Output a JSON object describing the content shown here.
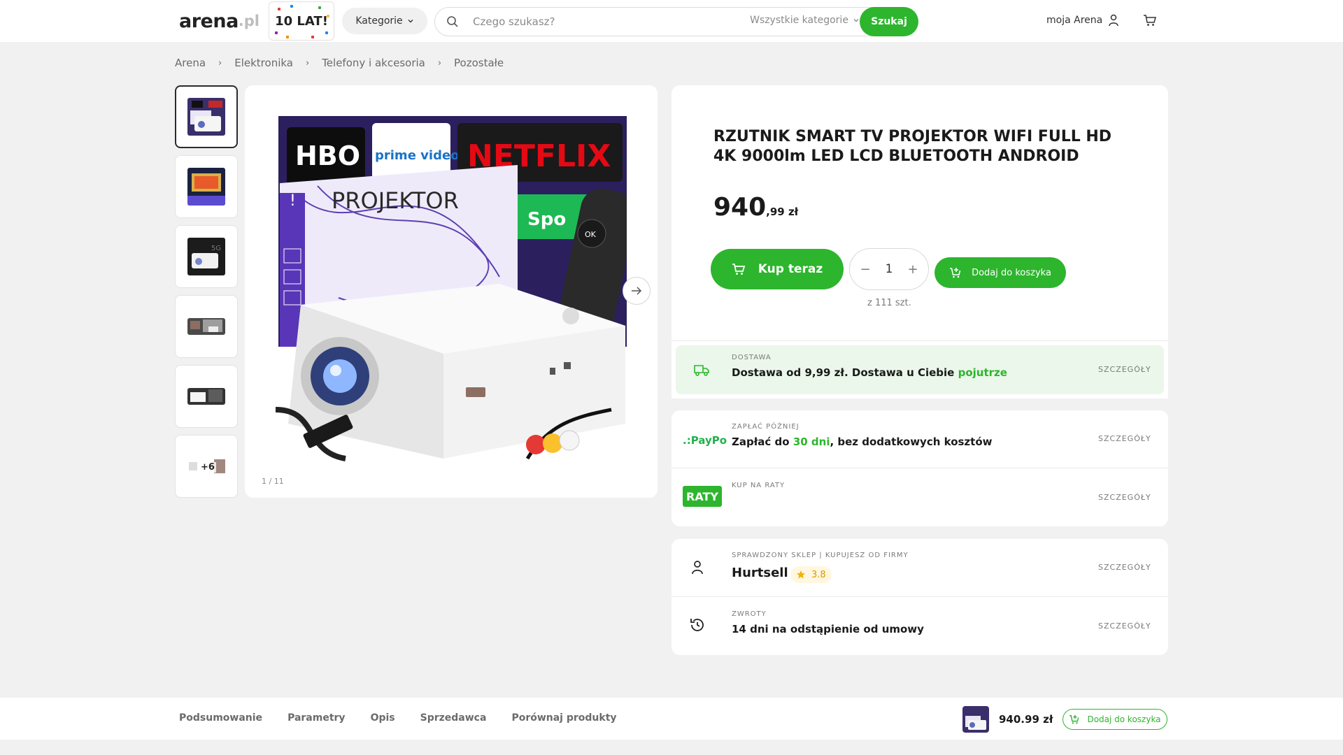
{
  "header": {
    "logo_main": "arena",
    "logo_suffix": ".pl",
    "anniversary": "10 LAT!",
    "categories_label": "Kategorie",
    "search_placeholder": "Czego szukasz?",
    "search_category": "Wszystkie kategorie",
    "search_button": "Szukaj",
    "account_label": "moja Arena"
  },
  "breadcrumb": [
    "Arena",
    "Elektronika",
    "Telefony i akcesoria",
    "Pozostałe"
  ],
  "gallery": {
    "counter": "1 / 11",
    "more_label": "+6",
    "thumbnails": [
      "projector-box",
      "projector-room",
      "projector-5g",
      "projector-scene",
      "projector-wall",
      "projector-accessories"
    ]
  },
  "product": {
    "title": "RZUTNIK SMART TV PROJEKTOR WIFI FULL HD 4K 9000lm LED LCD BLUETOOTH ANDROID",
    "price_int": "940",
    "price_dec": ",99 zł",
    "buy_now": "Kup teraz",
    "quantity": "1",
    "qty_minus": "−",
    "qty_plus": "+",
    "stock_note": "z 111 szt.",
    "add_to_cart": "Dodaj do koszyka"
  },
  "delivery": {
    "label": "DOSTAWA",
    "text": "Dostawa od 9,99 zł. Dostawa u Ciebie ",
    "highlight": "pojutrze",
    "link": "SZCZEGÓŁY"
  },
  "payment": {
    "paypo_logo": ".:PayPo",
    "paypo_label": "ZAPŁAĆ PÓŹNIEJ",
    "paypo_text_1": "Zapłać do ",
    "paypo_highlight": "30 dni",
    "paypo_text_2": ", bez dodatkowych kosztów",
    "paypo_link": "SZCZEGÓŁY",
    "raty_logo": "RATY",
    "raty_label": "KUP NA RATY",
    "raty_link": "SZCZEGÓŁY"
  },
  "seller": {
    "label": "SPRAWDZONY SKLEP | KUPUJESZ OD FIRMY",
    "name": "Hurtsell",
    "rating": "3.8",
    "link": "SZCZEGÓŁY",
    "returns_label": "ZWROTY",
    "returns_text": "14 dni na odstąpienie od umowy",
    "returns_link": "SZCZEGÓŁY"
  },
  "bottom_bar": {
    "tabs": [
      "Podsumowanie",
      "Parametry",
      "Opis",
      "Sprzedawca",
      "Porównaj produkty"
    ],
    "price": "940.99 zł",
    "add_to_cart": "Dodaj do koszyka"
  },
  "colors": {
    "accent": "#2db52d",
    "background": "#f1f1f1",
    "rating": "#f0b400"
  }
}
